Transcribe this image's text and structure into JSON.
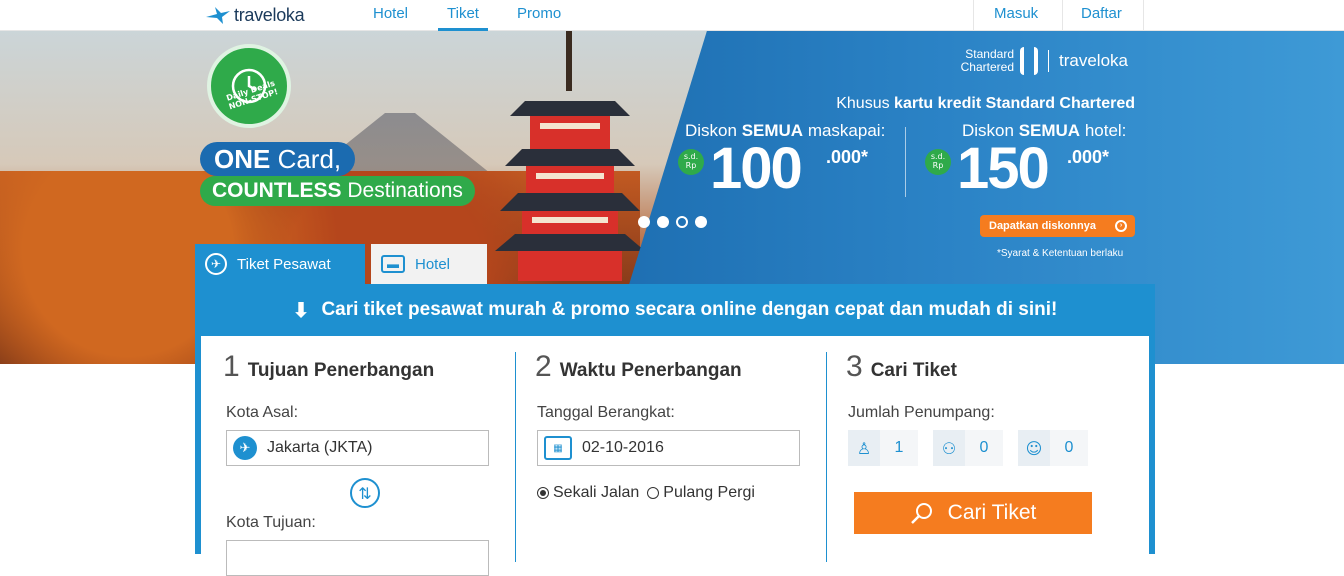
{
  "nav": {
    "logo": "traveloka",
    "links": [
      "Hotel",
      "Tiket",
      "Promo"
    ],
    "active": "Tiket",
    "right": [
      "Masuk",
      "Daftar"
    ]
  },
  "hero": {
    "badge": "Daily Deals NON-STOP!",
    "line1_bold": "ONE",
    "line1_rest": " Card,",
    "line2_bold": "COUNTLESS",
    "line2_rest": " Destinations",
    "partner_sc": "Standard Chartered",
    "partner_tv": "traveloka",
    "headline_pre": "Khusus ",
    "headline_bold": "kartu kredit Standard Chartered",
    "flight_pre": "Diskon ",
    "flight_bold": "SEMUA",
    "flight_post": " maskapai:",
    "hotel_pre": "Diskon ",
    "hotel_bold": "SEMUA",
    "hotel_post": " hotel:",
    "rp_tag": "s.d. Rp",
    "flight_amount": "100",
    "flight_suffix": ".000*",
    "hotel_amount": "150",
    "hotel_suffix": ".000*",
    "cta": "Dapatkan diskonnya",
    "terms": "*Syarat & Ketentuan berlaku",
    "slides": 4,
    "active_slide": 3
  },
  "tabs": [
    {
      "label": "Tiket Pesawat",
      "icon": "plane-icon",
      "active": true
    },
    {
      "label": "Hotel",
      "icon": "bed-icon",
      "active": false
    }
  ],
  "search": {
    "headline": "Cari tiket pesawat murah & promo secara online dengan cepat dan mudah di sini!",
    "step1": {
      "num": "1",
      "title": "Tujuan Penerbangan",
      "origin_label": "Kota Asal:",
      "origin_value": "Jakarta (JKTA)",
      "dest_label": "Kota Tujuan:"
    },
    "step2": {
      "num": "2",
      "title": "Waktu Penerbangan",
      "date_label": "Tanggal Berangkat:",
      "date_value": "02-10-2016",
      "oneway": "Sekali Jalan",
      "roundtrip": "Pulang Pergi"
    },
    "step3": {
      "num": "3",
      "title": "Cari Tiket",
      "pax_label": "Jumlah Penumpang:",
      "adult": "1",
      "child": "0",
      "infant": "0",
      "button": "Cari Tiket"
    }
  },
  "colors": {
    "blue": "#1e90d0",
    "orange": "#f57c1f",
    "green": "#2faa4a"
  }
}
